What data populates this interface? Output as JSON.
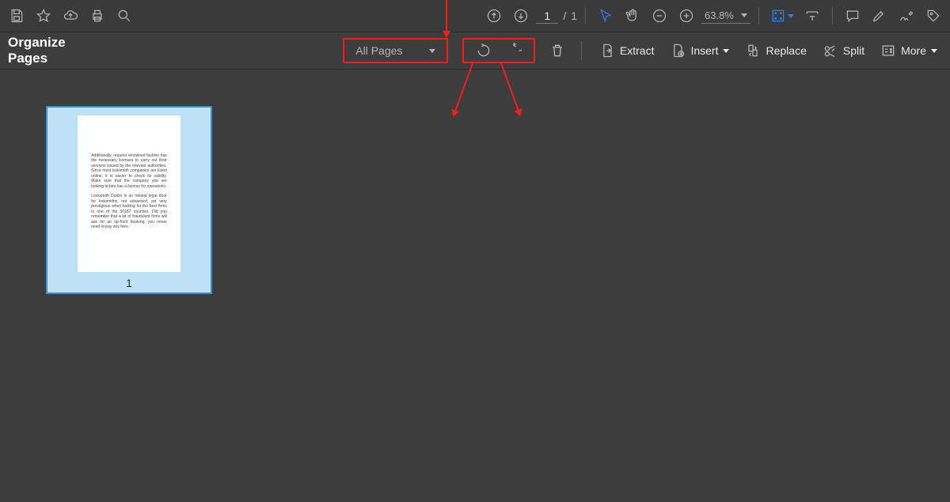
{
  "top_toolbar": {
    "page_input": "1",
    "page_total": "1",
    "zoom_value": "63.8%"
  },
  "organize": {
    "title": "Organize Pages",
    "all_pages_label": "All Pages",
    "extract_label": "Extract",
    "insert_label": "Insert",
    "replace_label": "Replace",
    "split_label": "Split",
    "more_label": "More"
  },
  "thumbnail": {
    "page_number": "1"
  }
}
